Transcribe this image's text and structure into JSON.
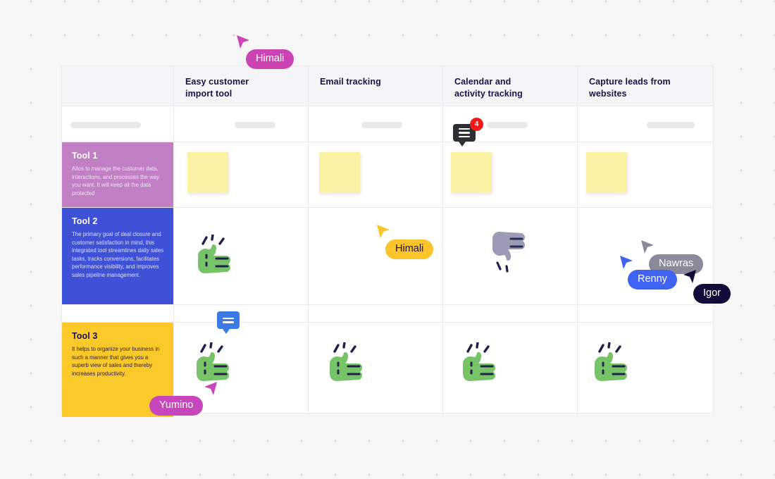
{
  "canvas": {
    "background_color": "#f6f6f7",
    "dot_color": "#dcdcde"
  },
  "board": {
    "columns": [
      {
        "label": "",
        "name": "row-label-column"
      },
      {
        "label": "Easy customer\nimport tool",
        "name": "col-easy-customer-import-tool"
      },
      {
        "label": "Email tracking",
        "name": "col-email-tracking"
      },
      {
        "label": "Calendar and\nactivity tracking",
        "name": "col-calendar-activity-tracking"
      },
      {
        "label": "Capture leads from\nwebsites",
        "name": "col-capture-leads-from-websites"
      }
    ],
    "header": {
      "c0": "",
      "c1_line1": "Easy customer",
      "c1_line2": "import tool",
      "c2_line1": "Email tracking",
      "c2_line2": "",
      "c3_line1": "Calendar and",
      "c3_line2": "activity tracking",
      "c4_line1": "Capture leads from",
      "c4_line2": "websites"
    },
    "rows": [
      {
        "title": "Tool 1",
        "description": "Allos to manage the customer data, interactions, and processes the way you want. It will keep all the data protected",
        "bg_color": "#c17fc4",
        "title_color": "#ffffff",
        "desc_color": "#f2e0f3",
        "cells": [
          "sticky-note",
          "sticky-note",
          "sticky-note",
          "sticky-note"
        ]
      },
      {
        "title": "Tool 2",
        "description": "The primary goal of deal closure and customer satisfaction in mind, this integrated tool streamlines daily sales tasks, tracks conversions, facilitates performance visibility, and improves sales pipeline management.",
        "bg_color": "#3f51d6",
        "title_color": "#ffffff",
        "desc_color": "#dbe0fb",
        "cells": [
          "thumbs-up",
          "empty",
          "thumbs-down",
          "empty"
        ]
      },
      {
        "title": "Tool 3",
        "description": "It helps to organize your business in such a manner that gives you a superb view of sales and thereby increases productivity.",
        "bg_color": "#fcc92b",
        "title_color": "#1b1149",
        "desc_color": "#2c2140",
        "cells": [
          "thumbs-up",
          "thumbs-up",
          "thumbs-up",
          "thumbs-up"
        ]
      }
    ]
  },
  "comments": [
    {
      "name": "comment-badge-calendar-tool1",
      "count": "4",
      "bubble_color": "#2f2f33",
      "badge_color": "#f01c1c",
      "lines": 3
    },
    {
      "name": "comment-bubble-tool3-easy-import",
      "count": "",
      "bubble_color": "#3d7ae4",
      "badge_color": "",
      "lines": 2
    }
  ],
  "cursors": [
    {
      "name": "cursor-himali-top",
      "label": "Himali",
      "color": "#cc44b4",
      "text_color": "#ffffff",
      "arrow_direction": "down-right"
    },
    {
      "name": "cursor-himali-email-tracking",
      "label": "Himali",
      "color": "#fbc42a",
      "text_color": "#1b1149",
      "arrow_direction": "down-right"
    },
    {
      "name": "cursor-nawras",
      "label": "Nawras",
      "color": "#8a8a99",
      "text_color": "#ffffff",
      "arrow_direction": "down-right"
    },
    {
      "name": "cursor-renny",
      "label": "Renny",
      "color": "#3f63f2",
      "text_color": "#ffffff",
      "arrow_direction": "down-right"
    },
    {
      "name": "cursor-igor",
      "label": "Igor",
      "color": "#130c38",
      "text_color": "#ffffff",
      "arrow_direction": "down-left"
    },
    {
      "name": "cursor-yumino",
      "label": "Yumino",
      "color": "#c746bb",
      "text_color": "#ffffff",
      "arrow_direction": "down-left"
    }
  ],
  "colors": {
    "sticky_note": "#faf1a2",
    "thumbs_up": "#77c367",
    "thumbs_down": "#9b9bb5",
    "border": "#eceaef",
    "header_bg": "#f5f5f7",
    "skeleton_bar": "#e9e8ea",
    "text_dark": "#1b1149"
  }
}
